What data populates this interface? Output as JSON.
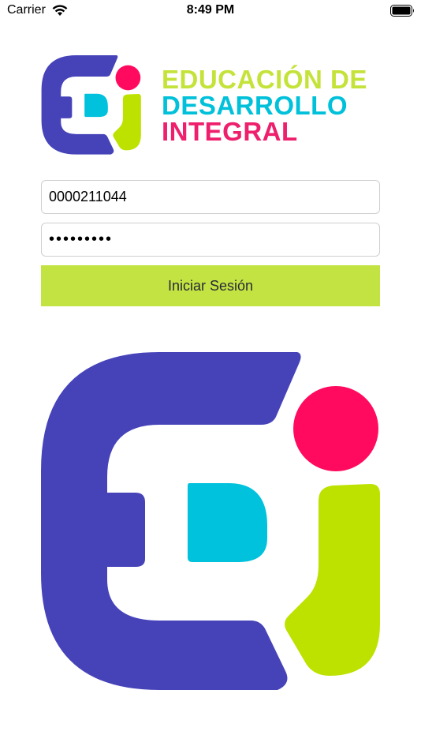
{
  "status_bar": {
    "carrier": "Carrier",
    "time": "8:49 PM",
    "icons": [
      "wifi-icon",
      "battery-icon"
    ]
  },
  "brand": {
    "line1": "EDUCACIÓN DE",
    "line2": "DESARROLLO",
    "line3": "INTEGRAL",
    "colors": {
      "purple": "#4643b9",
      "pink": "#ff0a5f",
      "cyan": "#00c2dc",
      "lime": "#bde200"
    }
  },
  "login": {
    "username_value": "0000211044",
    "password_value": "•••••••••",
    "button_label": "Iniciar Sesión",
    "button_color": "#c2e341"
  }
}
